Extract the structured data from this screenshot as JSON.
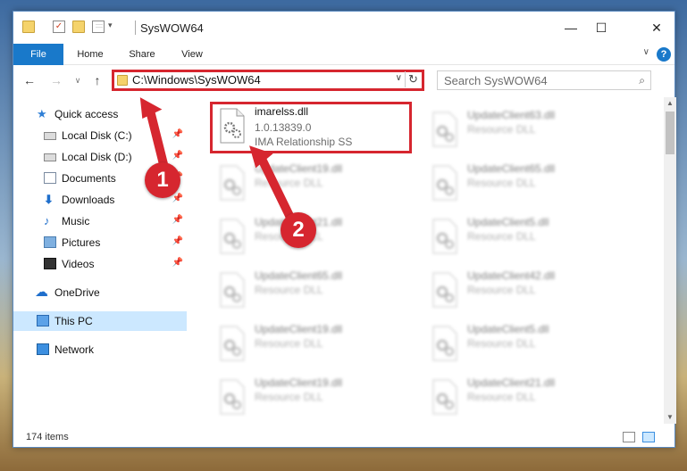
{
  "titlebar": {
    "title": "SysWOW64",
    "minimize": "—",
    "maximize": "☐",
    "close": "✕"
  },
  "ribbon": {
    "tabs": [
      "File",
      "Home",
      "Share",
      "View"
    ],
    "help": "?",
    "expand": "∨"
  },
  "nav": {
    "back": "←",
    "forward": "→",
    "recent": "∨",
    "up": "↑",
    "address": "C:\\Windows\\SysWOW64",
    "address_dropdown": "∨",
    "refresh": "↻",
    "search_placeholder": "Search SysWOW64"
  },
  "sidebar": {
    "items": [
      {
        "label": "Quick access",
        "icon": "star-icon"
      },
      {
        "label": "Local Disk (C:)",
        "icon": "drive-icon",
        "pinned": true
      },
      {
        "label": "Local Disk (D:)",
        "icon": "drive-icon",
        "pinned": true
      },
      {
        "label": "Documents",
        "icon": "documents-icon",
        "pinned": true
      },
      {
        "label": "Downloads",
        "icon": "downloads-icon",
        "pinned": true
      },
      {
        "label": "Music",
        "icon": "music-icon",
        "pinned": true
      },
      {
        "label": "Pictures",
        "icon": "pictures-icon",
        "pinned": true
      },
      {
        "label": "Videos",
        "icon": "videos-icon",
        "pinned": true
      },
      {
        "label": "OneDrive",
        "icon": "onedrive-icon"
      },
      {
        "label": "This PC",
        "icon": "this-pc-icon",
        "selected": true
      },
      {
        "label": "Network",
        "icon": "network-icon"
      }
    ]
  },
  "files": {
    "highlighted": {
      "name": "imarelss.dll",
      "version": "1.0.13839.0",
      "description": "IMA Relationship SS"
    },
    "column1": [
      {
        "name": "UpdateClient19.dll",
        "description": "Resource DLL"
      },
      {
        "name": "UpdateClient21.dll",
        "description": "Resource DLL"
      },
      {
        "name": "UpdateClient65.dll",
        "description": "Resource DLL"
      },
      {
        "name": "UpdateClient19.dll",
        "description": "Resource DLL"
      },
      {
        "name": "UpdateClient19.dll",
        "description": "Resource DLL"
      }
    ],
    "column2": [
      {
        "name": "UpdateClient63.dll",
        "description": "Resource DLL"
      },
      {
        "name": "UpdateClient65.dll",
        "description": "Resource DLL"
      },
      {
        "name": "UpdateClient5.dll",
        "description": "Resource DLL"
      },
      {
        "name": "UpdateClient42.dll",
        "description": "Resource DLL"
      },
      {
        "name": "UpdateClient5.dll",
        "description": "Resource DLL"
      },
      {
        "name": "UpdateClient21.dll",
        "description": "Resource DLL"
      }
    ]
  },
  "status": {
    "item_count": "174 items"
  },
  "annotations": {
    "marker1": "1",
    "marker2": "2",
    "color": "#d6262f"
  }
}
